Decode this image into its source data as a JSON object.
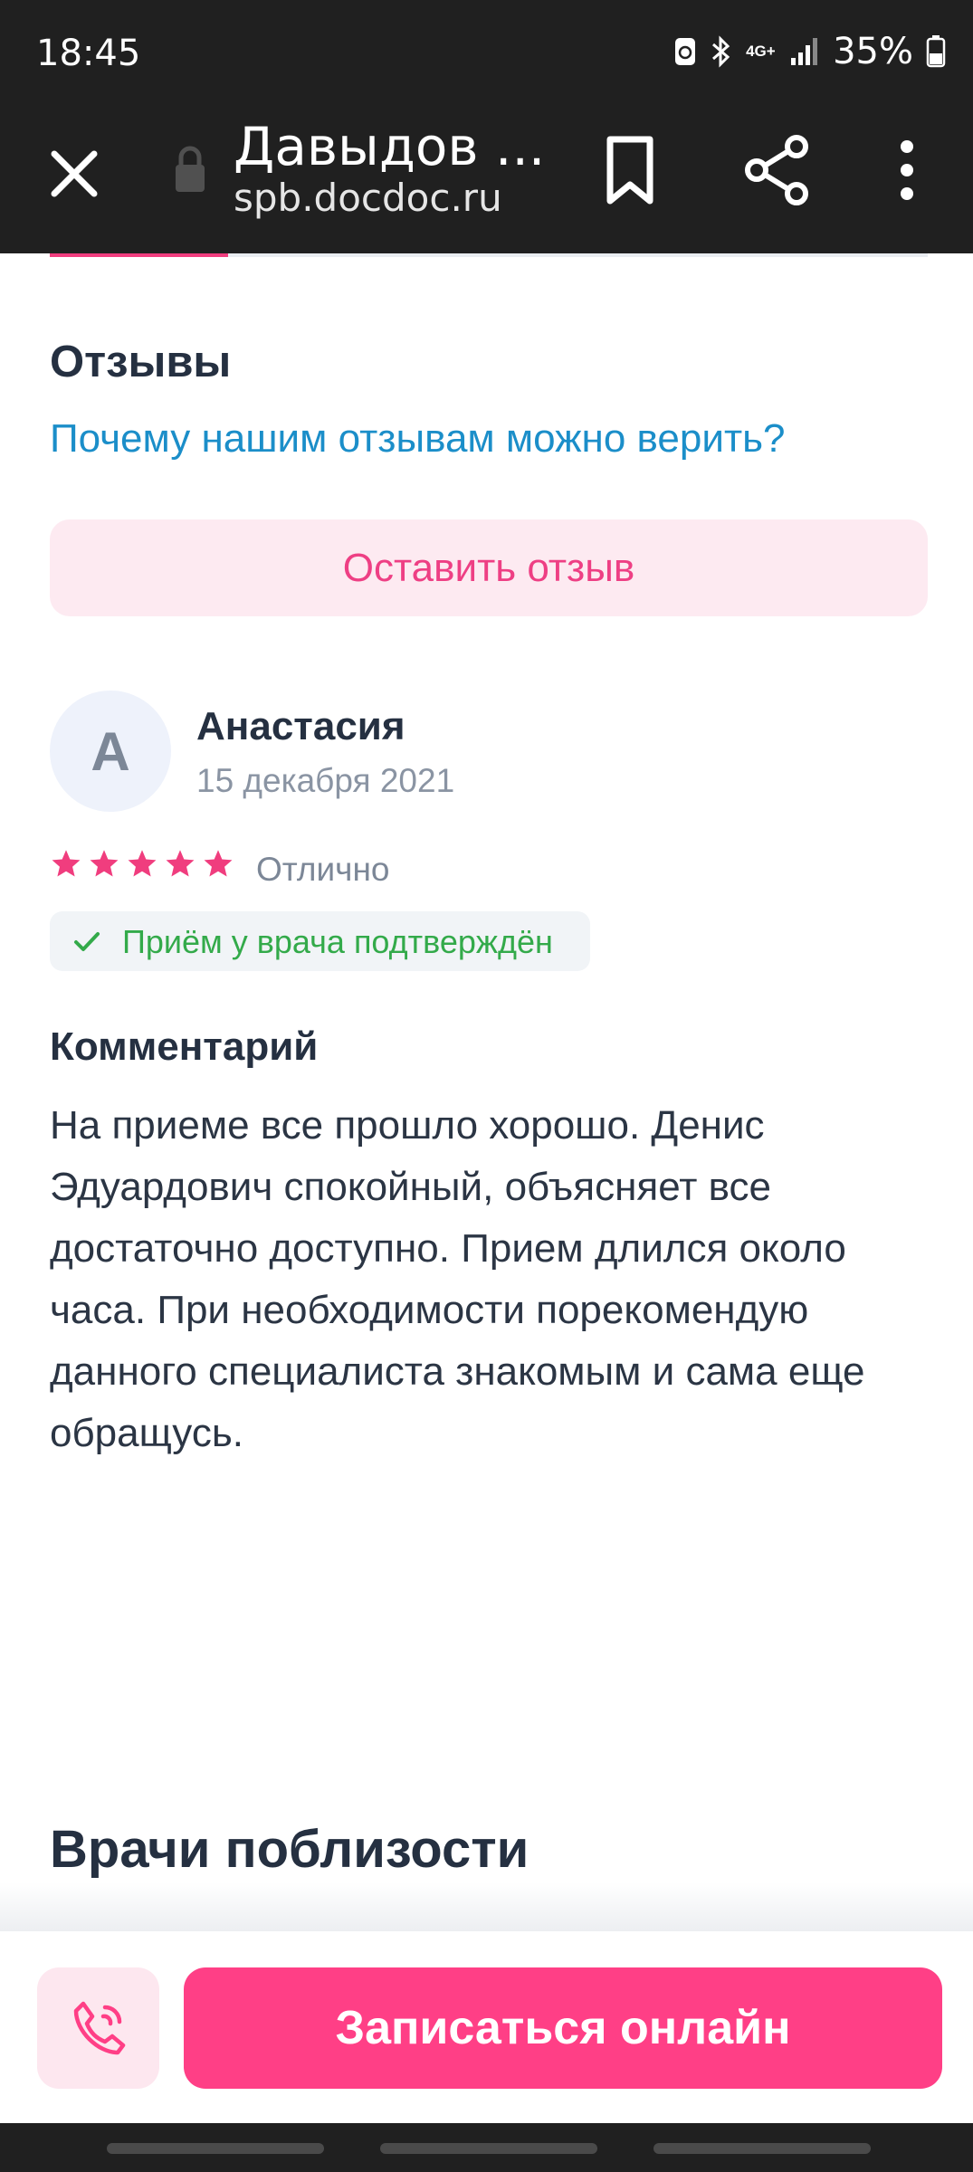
{
  "status_bar": {
    "time": "18:45",
    "network": "4G+",
    "battery": "35%"
  },
  "browser": {
    "title": "Давыдов ...",
    "url": "spb.docdoc.ru",
    "icons": [
      "close-icon",
      "lock-icon",
      "bookmark-icon",
      "share-icon",
      "more-icon"
    ]
  },
  "reviews": {
    "title": "Отзывы",
    "why_link": "Почему нашим отзывам можно верить?",
    "leave_button": "Оставить отзыв"
  },
  "review": {
    "avatar_letter": "А",
    "author": "Анастасия",
    "date": "15 декабря 2021",
    "stars": 5,
    "rating_label": "Отлично",
    "verified": "Приём у врача подтверждён",
    "comment_title": "Комментарий",
    "comment": "На приеме все прошло хорошо. Денис Эдуардович спокойный, объясняет все достаточно доступно. Прием длился около часа. При необходимости порекомендую данного специалиста знакомым и сама еще обращусь."
  },
  "nearby": {
    "title": "Врачи поблизости"
  },
  "actions": {
    "book_button": "Записаться онлайн",
    "call_icon": "phone-icon"
  },
  "colors": {
    "accent": "#ff3f86",
    "link": "#1b8ec9",
    "verified": "#33aa4a",
    "text": "#253041"
  }
}
